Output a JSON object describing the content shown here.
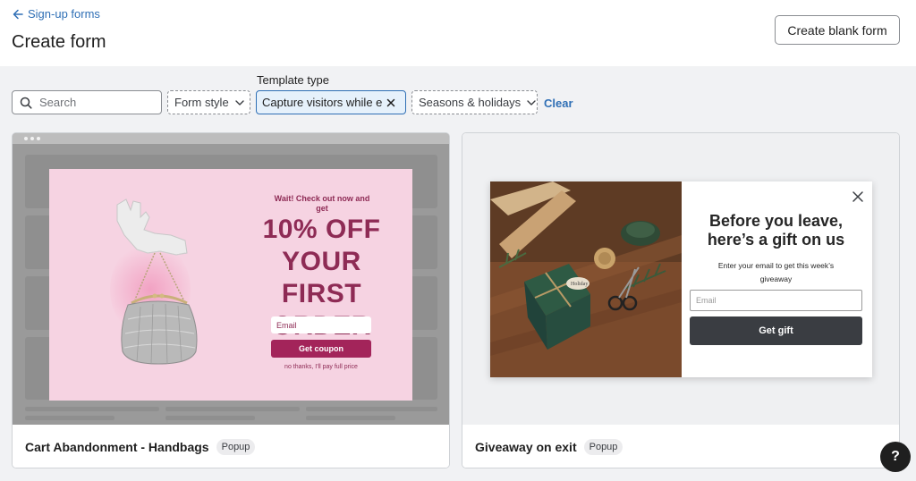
{
  "header": {
    "back_label": "Sign-up forms",
    "title": "Create form",
    "create_blank_label": "Create blank form"
  },
  "filters": {
    "search_placeholder": "Search",
    "template_type_label": "Template type",
    "form_style_label": "Form style",
    "template_type_selected": "Capture visitors while exi",
    "seasons_label": "Seasons & holidays",
    "clear_label": "Clear"
  },
  "cards": [
    {
      "title": "Cart Abandonment - Handbags",
      "badge": "Popup",
      "preview": {
        "eyebrow": "Wait! Check out now and get",
        "headline": "10% OFF YOUR FIRST ORDER",
        "email_placeholder": "Email",
        "button": "Get coupon",
        "decline": "no thanks, I'll pay full price",
        "accent": "#a3245a",
        "background": "#f6d3e2"
      }
    },
    {
      "title": "Giveaway on exit",
      "badge": "Popup",
      "preview": {
        "headline": "Before you leave, here’s a gift on us",
        "subtext": "Enter your email to get this week’s giveaway",
        "email_placeholder": "Email",
        "button": "Get gift",
        "button_color": "#3a3d42",
        "gift_tag_text": "Holiday"
      }
    }
  ],
  "help": {
    "label": "?"
  },
  "icons": {
    "back": "arrow-left-icon",
    "search": "search-icon",
    "dropdown": "chevron-down-icon",
    "remove": "close-icon",
    "popup_close": "close-icon"
  },
  "colors": {
    "link": "#2f6fb5",
    "chip_bg": "#e6f1fb"
  }
}
